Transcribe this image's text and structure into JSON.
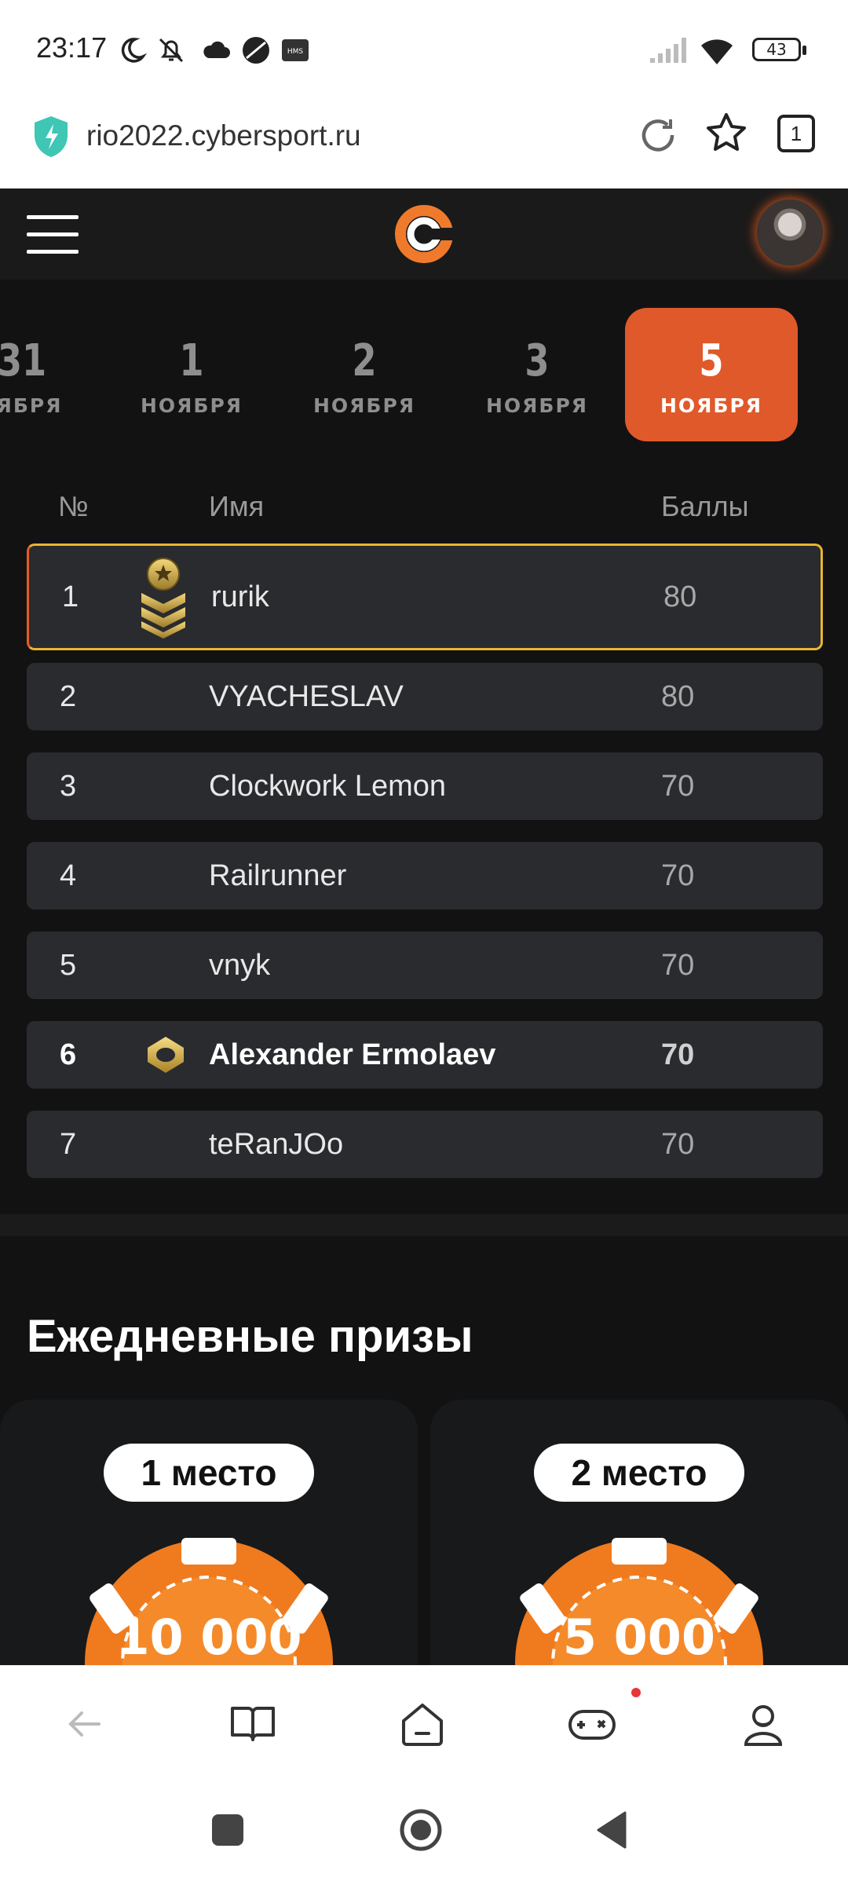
{
  "status_bar": {
    "time": "23:17",
    "battery": "43",
    "icons": [
      "moon-icon",
      "bell-off-icon",
      "cloud-icon",
      "app-icon",
      "hms-icon",
      "signal-icon",
      "wifi-icon",
      "battery-icon"
    ]
  },
  "browser": {
    "url": "rio2022.cybersport.ru",
    "tab_count": "1"
  },
  "site": {
    "logo": "cybersport-logo"
  },
  "dates": [
    {
      "num": "31",
      "month": "ТЯБРЯ"
    },
    {
      "num": "1",
      "month": "НОЯБРЯ"
    },
    {
      "num": "2",
      "month": "НОЯБРЯ"
    },
    {
      "num": "3",
      "month": "НОЯБРЯ"
    },
    {
      "num": "5",
      "month": "НОЯБРЯ",
      "active": true
    }
  ],
  "table": {
    "headers": {
      "rank": "№",
      "name": "Имя",
      "points": "Баллы"
    },
    "rows": [
      {
        "rank": "1",
        "name": "rurik",
        "points": "80",
        "badge": "gold-rank-chevron-icon"
      },
      {
        "rank": "2",
        "name": "VYACHESLAV",
        "points": "80"
      },
      {
        "rank": "3",
        "name": "Clockwork Lemon",
        "points": "70"
      },
      {
        "rank": "4",
        "name": "Railrunner",
        "points": "70"
      },
      {
        "rank": "5",
        "name": "vnyk",
        "points": "70"
      },
      {
        "rank": "6",
        "name": "Alexander Ermolaev",
        "points": "70",
        "badge": "gold-rank-ring-icon",
        "current_user": true
      },
      {
        "rank": "7",
        "name": "teRanJOo",
        "points": "70"
      }
    ]
  },
  "prizes": {
    "title": "Ежедневные призы",
    "cards": [
      {
        "place": "1 место",
        "amount": "10 000"
      },
      {
        "place": "2 место",
        "amount": "5 000"
      }
    ]
  },
  "colors": {
    "accent": "#e0592a",
    "gold": "#e7b533",
    "dark_bg": "#121212",
    "row_bg": "#2a2b2e"
  }
}
